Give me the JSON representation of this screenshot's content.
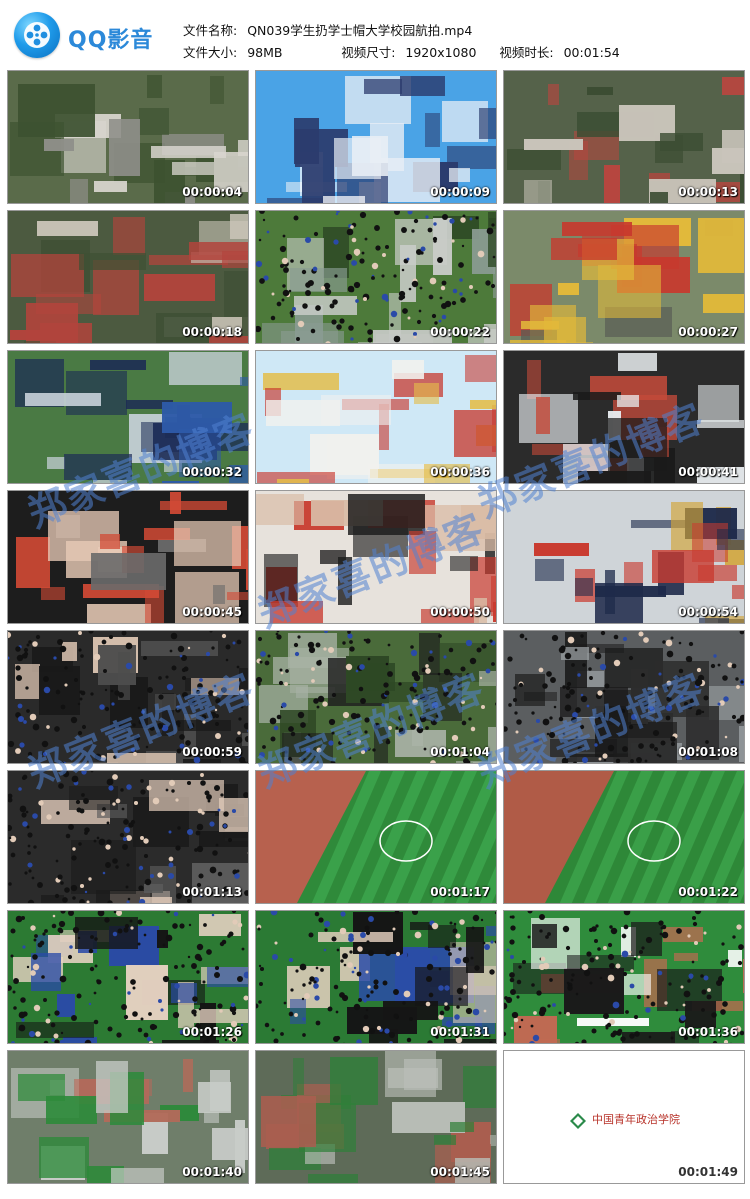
{
  "app": {
    "logo_text": "QQ影音"
  },
  "file": {
    "name_label": "文件名称:",
    "name_value": "QN039学生扔学士帽大学校园航拍.mp4",
    "size_label": "文件大小:",
    "size_value": "98MB",
    "dims_label": "视频尺寸:",
    "dims_value": "1920x1080",
    "duration_label": "视频时长:",
    "duration_value": "00:01:54"
  },
  "thumbnails": [
    {
      "time": "00:00:04",
      "scene": "aerial-building"
    },
    {
      "time": "00:00:09",
      "scene": "tower-sky"
    },
    {
      "time": "00:00:13",
      "scene": "aerial-red-building"
    },
    {
      "time": "00:00:18",
      "scene": "aerial-red-building-2"
    },
    {
      "time": "00:00:22",
      "scene": "campus-crowd-tree"
    },
    {
      "time": "00:00:27",
      "scene": "professors-walking"
    },
    {
      "time": "00:00:32",
      "scene": "ceremony-stage"
    },
    {
      "time": "00:00:36",
      "scene": "speaker-podium"
    },
    {
      "time": "00:00:41",
      "scene": "diploma-hand"
    },
    {
      "time": "00:00:45",
      "scene": "diploma-handover"
    },
    {
      "time": "00:00:50",
      "scene": "graduates-hats"
    },
    {
      "time": "00:00:54",
      "scene": "graduate-smile"
    },
    {
      "time": "00:00:59",
      "scene": "auditorium-cheer"
    },
    {
      "time": "00:01:04",
      "scene": "aerial-crowd-trees"
    },
    {
      "time": "00:01:08",
      "scene": "crowd-building"
    },
    {
      "time": "00:01:13",
      "scene": "cheering-crowd"
    },
    {
      "time": "00:01:17",
      "scene": "soccer-field"
    },
    {
      "time": "00:01:22",
      "scene": "soccer-field-2"
    },
    {
      "time": "00:01:26",
      "scene": "crowd-grass"
    },
    {
      "time": "00:01:31",
      "scene": "crowd-grass-2"
    },
    {
      "time": "00:01:36",
      "scene": "circle-formation"
    },
    {
      "time": "00:01:40",
      "scene": "aerial-city"
    },
    {
      "time": "00:01:45",
      "scene": "aerial-city-2"
    },
    {
      "time": "00:01:49",
      "scene": "school-logo-card"
    }
  ],
  "school_logo_text": "中国青年政治学院",
  "watermark_text": "郑家喜的博客",
  "colors": {
    "brand": "#2c89d9",
    "timestamp": "#ffffff"
  }
}
